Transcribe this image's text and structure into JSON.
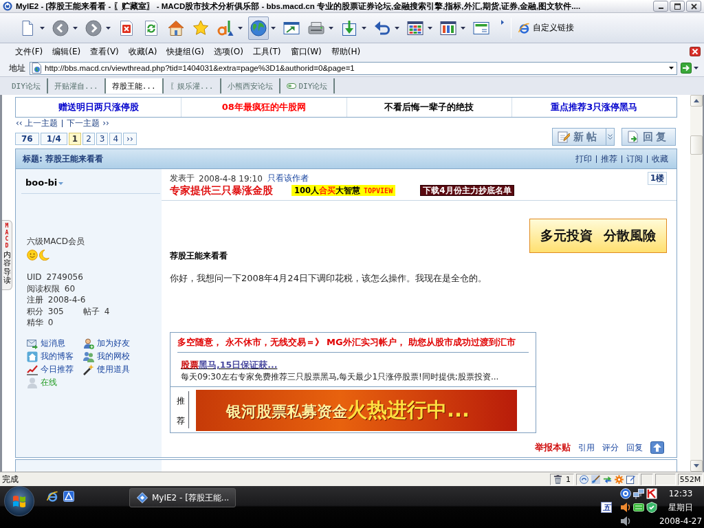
{
  "window": {
    "title": "MyIE2 - [荐股王能来看看 - 〖贮藏室〗 - MACD股市技术分析俱乐部 - bbs.macd.cn 专业的股票证券论坛,金融搜索引擎,指标,外汇,期货,证券,金融,图文软件...."
  },
  "toolbar": {
    "buttons": [
      {
        "kind": "new",
        "dropdown": true,
        "pressed": false
      },
      {
        "kind": "back",
        "dropdown": true,
        "pressed": false
      },
      {
        "kind": "forward",
        "dropdown": true,
        "pressed": false
      },
      {
        "kind": "stop",
        "dropdown": false,
        "pressed": false
      },
      {
        "kind": "refresh",
        "dropdown": false,
        "pressed": false
      },
      {
        "kind": "home",
        "dropdown": false,
        "pressed": false
      },
      {
        "kind": "favorites",
        "dropdown": false,
        "pressed": false
      },
      {
        "kind": "font",
        "dropdown": true,
        "pressed": false
      },
      {
        "kind": "globe",
        "dropdown": true,
        "pressed": true
      },
      {
        "kind": "popup",
        "dropdown": false,
        "pressed": false
      },
      {
        "kind": "device",
        "dropdown": true,
        "pressed": false
      },
      {
        "kind": "download",
        "dropdown": true,
        "pressed": false
      },
      {
        "kind": "undo",
        "dropdown": true,
        "pressed": false
      },
      {
        "kind": "grid",
        "dropdown": true,
        "pressed": false
      },
      {
        "kind": "columns",
        "dropdown": true,
        "pressed": false
      },
      {
        "kind": "window",
        "dropdown": false,
        "pressed": false
      }
    ],
    "links_label": "自定义链接"
  },
  "menu": [
    "文件(F)",
    "编辑(E)",
    "查看(V)",
    "收藏(A)",
    "快捷组(G)",
    "选项(O)",
    "工具(T)",
    "窗口(W)",
    "帮助(H)"
  ],
  "address": {
    "label": "地址",
    "value": "http://bbs.macd.cn/viewthread.php?tid=1404031&extra=page%3D1&authorid=0&page=1"
  },
  "tabs": [
    {
      "label": "DIY论坛",
      "selected": false,
      "icon": false
    },
    {
      "label": "开贴灌自...",
      "selected": false,
      "icon": false
    },
    {
      "label": "荐股王能...",
      "selected": true,
      "icon": false
    },
    {
      "label": "〖娱乐灌...",
      "selected": false,
      "icon": false
    },
    {
      "label": "小熊西安论坛",
      "selected": false,
      "icon": false
    },
    {
      "label": "DIY论坛",
      "selected": false,
      "icon": true
    }
  ],
  "side_tab": {
    "title": "MACD",
    "label": "内容导读"
  },
  "promo_links": [
    {
      "text": "赠送明日两只涨停股",
      "color": "#0000cc"
    },
    {
      "text": "08年最疯狂的牛股网",
      "color": "#ff0000"
    },
    {
      "text": "不看后悔一辈子的绝技",
      "color": "#000000"
    },
    {
      "text": "重点推荐3只涨停黑马",
      "color": "#0000cc"
    }
  ],
  "thread_nav": {
    "prev": "‹‹ 上一主题",
    "next": "下一主题 ››"
  },
  "pager": {
    "total": "76",
    "pages": "1/4",
    "items": [
      {
        "label": "1",
        "selected": true
      },
      {
        "label": "2",
        "selected": false
      },
      {
        "label": "3",
        "selected": false
      },
      {
        "label": "4",
        "selected": false
      }
    ],
    "next": "››"
  },
  "actions": [
    {
      "label": "新帖",
      "kind": "new",
      "dropdown": true
    },
    {
      "label": "回复",
      "kind": "reply",
      "dropdown": false
    }
  ],
  "thread": {
    "title": "标题: 荐股王能来看看",
    "tools": [
      "打印",
      "推荐",
      "订阅",
      "收藏"
    ]
  },
  "post": {
    "author": {
      "name": "boo-bi",
      "rank": "六级MACD会员",
      "rank_icons": [
        {
          "kind": "sun"
        },
        {
          "kind": "moon"
        }
      ],
      "stat_rows": [
        [
          "UID 2749056"
        ],
        [
          "阅读权限 60"
        ],
        [
          "注册 2008-4-6"
        ],
        [
          "积分 305",
          "帖子 4"
        ],
        [
          "精华 0"
        ]
      ],
      "links": [
        {
          "label": "短消息",
          "kind": "message"
        },
        {
          "label": "加为好友",
          "kind": "add-friend"
        },
        {
          "label": "我的博客",
          "kind": "blog"
        },
        {
          "label": "我的网校",
          "kind": "school"
        },
        {
          "label": "今日推荐",
          "kind": "recommend"
        },
        {
          "label": "使用道具",
          "kind": "tool"
        },
        {
          "label": "在线",
          "kind": "online"
        }
      ]
    },
    "posted_label": "发表于",
    "time": "2008-4-8 19:10",
    "author_only": "只看该作者",
    "floor": "1楼",
    "promo_headline": "专家提供三只暴涨金股",
    "badge_parts": [
      "100人",
      "合买",
      "大智慧",
      "TOPVIEW"
    ],
    "download_badge": "下载4月份主力抄底名单",
    "side_ad": "多元投資 分散風險",
    "title": "荐股王能来看看",
    "body": "你好，我想问一下2008年4月24日下调印花税，该怎么操作。我现在是全仓的。",
    "ad_box": {
      "headline": "多空随意， 永不休市，无线交易＝》 MG外汇实习帐户， 助您从股市成功过渡到汇市",
      "link_parts": [
        "股票",
        "黑马,15日保证获..."
      ],
      "description": "每天09:30左右专家免费推荐三只股票黑马,每天最少1只涨停股票!同时提供;股票投资...",
      "recommend_label": "推荐",
      "banner_parts": [
        "银河股票私募资金",
        "火热进行中..."
      ]
    },
    "footer": [
      {
        "label": "举报本贴",
        "kind": "report"
      },
      {
        "label": "引用",
        "kind": "link"
      },
      {
        "label": "评分",
        "kind": "link"
      },
      {
        "label": "回复",
        "kind": "link"
      }
    ]
  },
  "status_bar": {
    "text": "完成",
    "trash_count": "1",
    "memory": "552M"
  },
  "taskbar": {
    "task": "MyIE2 - [荐股王能...",
    "ime": "五",
    "time": "12:33",
    "weekday": "星期日",
    "date": "2008-4-27"
  }
}
